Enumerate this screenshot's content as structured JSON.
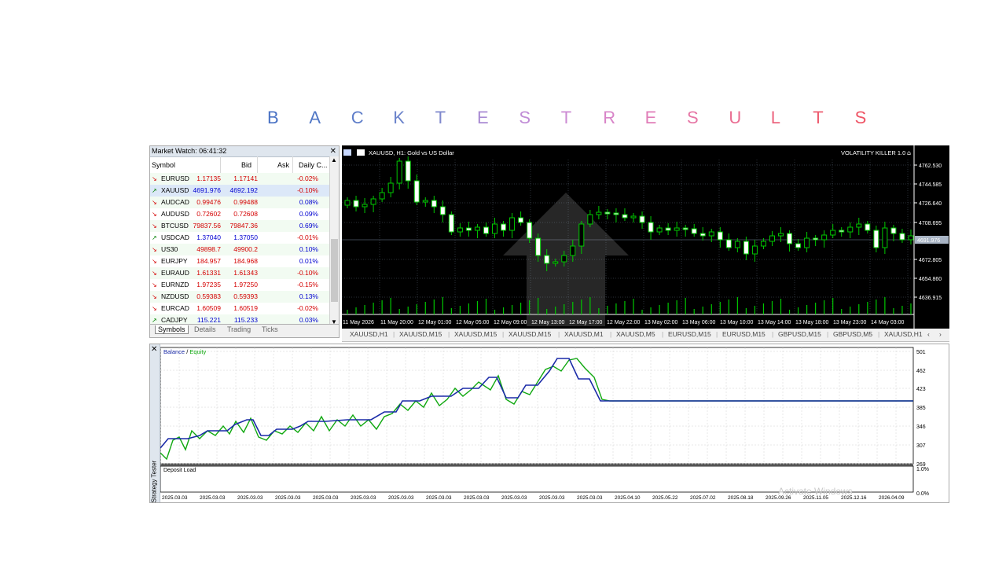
{
  "title": {
    "letters": [
      "B",
      "A",
      "C",
      "K",
      "T",
      "E",
      "S",
      "T",
      "R",
      "E",
      "S",
      "U",
      "L",
      "T",
      "S"
    ],
    "colors": [
      "#4a72c4",
      "#5278c6",
      "#5f7ec9",
      "#6c84cb",
      "#7f88cd",
      "#a98bd3",
      "#c08cd6",
      "#cc8ad3",
      "#d884c8",
      "#e07db8",
      "#e676a5",
      "#ea6d92",
      "#ec657f",
      "#ee5d70",
      "#ef5566"
    ]
  },
  "market_watch": {
    "title": "Market Watch: 06:41:32",
    "close": "✕",
    "columns": [
      "Symbol",
      "Bid",
      "Ask",
      "Daily C..."
    ],
    "rows": [
      {
        "symbol": "EURUSD",
        "bid": "1.17135",
        "ask": "1.17141",
        "change": "-0.02%",
        "dir": "down"
      },
      {
        "symbol": "XAUUSD",
        "bid": "4691.976",
        "ask": "4692.192",
        "change": "-0.10%",
        "dir": "up"
      },
      {
        "symbol": "AUDCAD",
        "bid": "0.99476",
        "ask": "0.99488",
        "change": "0.08%",
        "dir": "down"
      },
      {
        "symbol": "AUDUSD",
        "bid": "0.72602",
        "ask": "0.72608",
        "change": "0.09%",
        "dir": "down"
      },
      {
        "symbol": "BTCUSD",
        "bid": "79837.56",
        "ask": "79847.36",
        "change": "0.69%",
        "dir": "down"
      },
      {
        "symbol": "USDCAD",
        "bid": "1.37040",
        "ask": "1.37050",
        "change": "-0.01%",
        "dir": "up"
      },
      {
        "symbol": "US30",
        "bid": "49898.7",
        "ask": "49900.2",
        "change": "0.10%",
        "dir": "down"
      },
      {
        "symbol": "EURJPY",
        "bid": "184.957",
        "ask": "184.968",
        "change": "0.01%",
        "dir": "down"
      },
      {
        "symbol": "EURAUD",
        "bid": "1.61331",
        "ask": "1.61343",
        "change": "-0.10%",
        "dir": "down"
      },
      {
        "symbol": "EURNZD",
        "bid": "1.97235",
        "ask": "1.97250",
        "change": "-0.15%",
        "dir": "down"
      },
      {
        "symbol": "NZDUSD",
        "bid": "0.59383",
        "ask": "0.59393",
        "change": "0.13%",
        "dir": "down"
      },
      {
        "symbol": "EURCAD",
        "bid": "1.60509",
        "ask": "1.60519",
        "change": "-0.02%",
        "dir": "down"
      },
      {
        "symbol": "CADJPY",
        "bid": "115.221",
        "ask": "115.233",
        "change": "0.03%",
        "dir": "up"
      }
    ],
    "tabs": [
      "Symbols",
      "Details",
      "Trading",
      "Ticks"
    ],
    "colors": {
      "bid_down": "#d40000",
      "bid_up": "#0000d0",
      "neg": "#d40000",
      "pos": "#0000d0",
      "up_arrow": "#008000",
      "down_arrow": "#d40000"
    }
  },
  "chart": {
    "symbol_label": "XAUUSD, H1: Gold vs US Dollar",
    "indicator": "VOLATILITY KILLER 1.0",
    "price_ticks": [
      "4762.530",
      "4744.585",
      "4726.640",
      "4708.695",
      "4672.805",
      "4654.860",
      "4636.915"
    ],
    "current_price": "4691.976",
    "time_labels": [
      "11 May 2026",
      "11 May 20:00",
      "12 May 01:00",
      "12 May 05:00",
      "12 May 09:00",
      "12 May 13:00",
      "12 May 17:00",
      "12 May 22:00",
      "13 May 02:00",
      "13 May 06:00",
      "13 May 10:00",
      "13 May 14:00",
      "13 May 18:00",
      "13 May 23:00",
      "14 May 03:00"
    ],
    "tabs": [
      "XAUUSD,H1",
      "XAUUSD,M15",
      "XAUUSD,M15",
      "XAUUSD,M15",
      "XAUUSD,M1",
      "XAUUSD,M5",
      "EURUSD,M15",
      "EURUSD,M15",
      "GBPUSD,M15",
      "GBPUSD,M5",
      "XAUUSD,H1"
    ],
    "nav_left": "‹",
    "nav_right": "›",
    "colors": {
      "bull": "#00c800",
      "bear_fill": "#ffffff",
      "grid": "#556070",
      "volume": "#00c800"
    }
  },
  "tester": {
    "legend_balance": "Balance",
    "legend_sep": " / ",
    "legend_equity": "Equity",
    "y_ticks": [
      "501",
      "462",
      "423",
      "385",
      "346",
      "307",
      "269"
    ],
    "deposit_label": "Deposit Load",
    "deposit_ticks": [
      "1.0%",
      "0.0%"
    ],
    "side_label": "Strategy Tester",
    "dates": [
      "2025.03.03",
      "2025.03.03",
      "2025.03.03",
      "2025.03.03",
      "2025.03.03",
      "2025.03.03",
      "2025.03.03",
      "2025.03.03",
      "2025.03.03",
      "2025.03.03",
      "2025.03.03",
      "2025.03.03",
      "2025.04.10",
      "2025.05.22",
      "2025.07.02",
      "2025.08.18",
      "2025.09.26",
      "2025.11.05",
      "2025.12.16",
      "2026.04.09"
    ],
    "colors": {
      "balance": "#1a2aa8",
      "equity": "#10a810",
      "grid": "#d0d0d0"
    }
  },
  "watermark": "Activate Windows"
}
